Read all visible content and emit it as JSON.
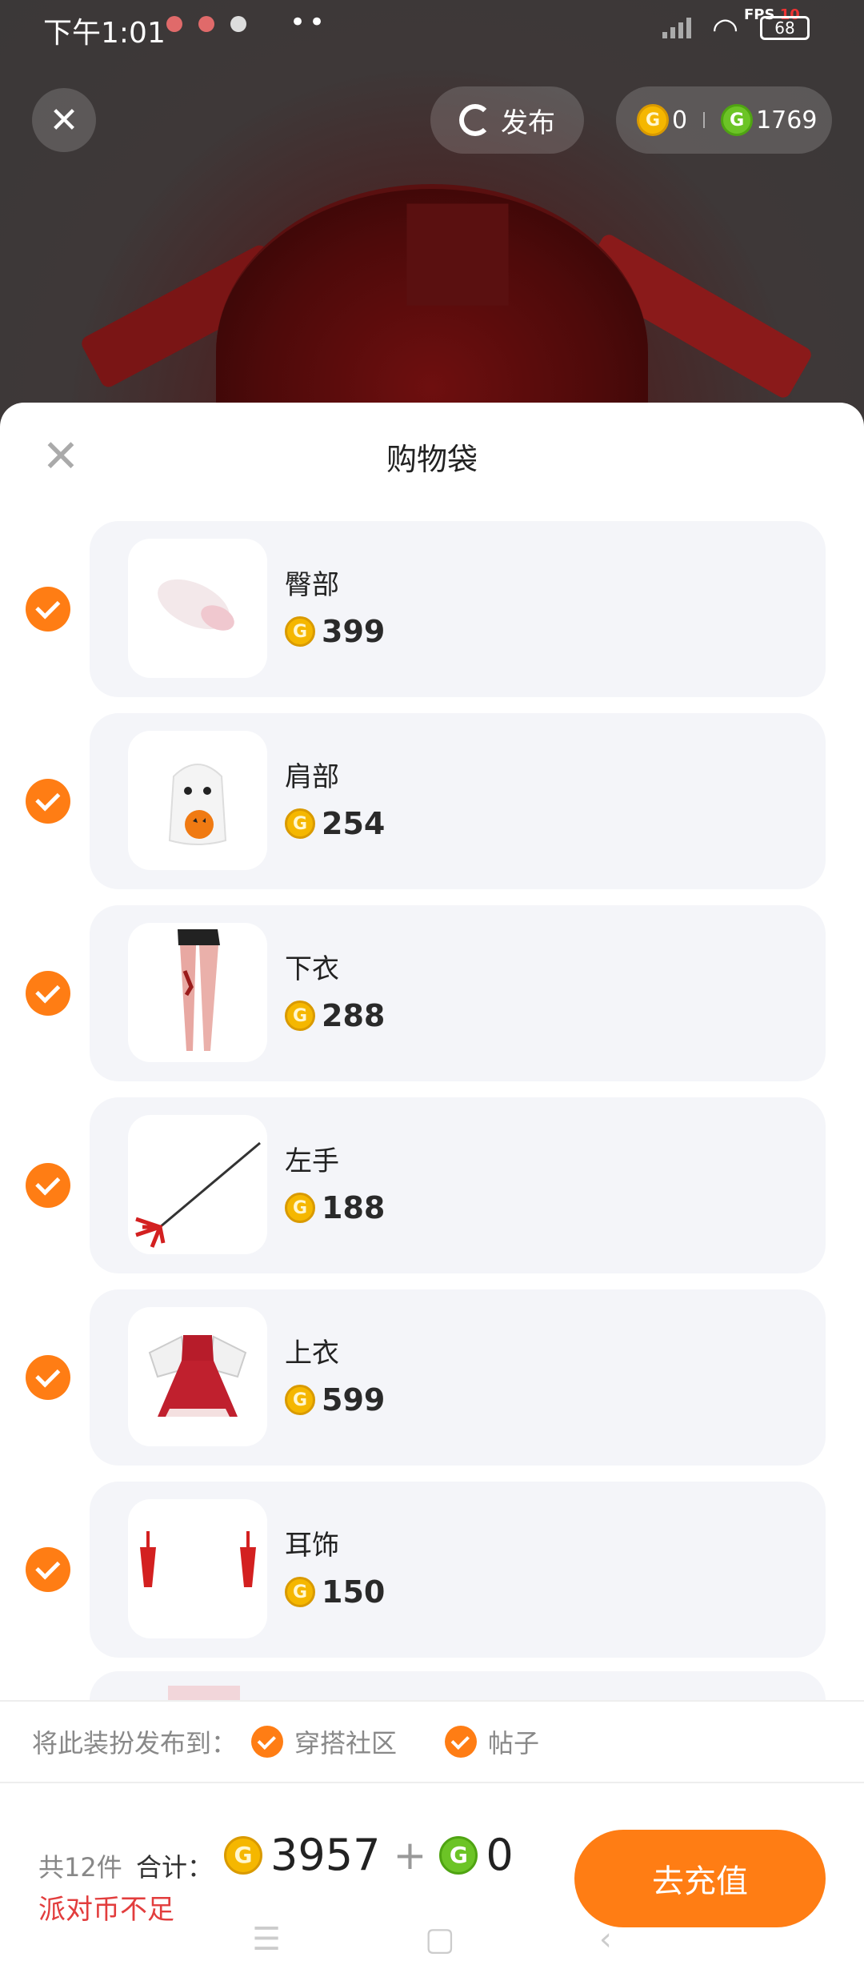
{
  "status_bar": {
    "time": "下午1:01",
    "dots": "••",
    "fps_label": "FPS",
    "fps_value": "10",
    "battery": "68"
  },
  "header": {
    "close_glyph": "✕",
    "publish_label": "发布",
    "gold_coins": "0",
    "green_coins": "1769"
  },
  "sheet": {
    "title": "购物袋",
    "close_glyph": "✕"
  },
  "items": [
    {
      "name": "臀部",
      "price": "399",
      "thumb": "tail"
    },
    {
      "name": "肩部",
      "price": "254",
      "thumb": "ghost"
    },
    {
      "name": "下衣",
      "price": "288",
      "thumb": "legs"
    },
    {
      "name": "左手",
      "price": "188",
      "thumb": "trident"
    },
    {
      "name": "上衣",
      "price": "599",
      "thumb": "dress"
    },
    {
      "name": "耳饰",
      "price": "150",
      "thumb": "earrings"
    }
  ],
  "publish_to": {
    "label": "将此装扮发布到：",
    "options": [
      "穿搭社区",
      "帖子"
    ]
  },
  "bottom": {
    "count": "共12件",
    "total_label": "合计：",
    "gold_total": "3957",
    "plus": "+",
    "green_total": "0",
    "insufficient": "派对币不足",
    "recharge": "去充值"
  },
  "coin_symbol": "G",
  "colors": {
    "accent": "#ff7d14",
    "gold_coin": "#f5b700",
    "green_coin": "#6cc426",
    "warning": "#e23d3d"
  },
  "navbar": [
    "☰",
    "▢",
    "‹"
  ]
}
